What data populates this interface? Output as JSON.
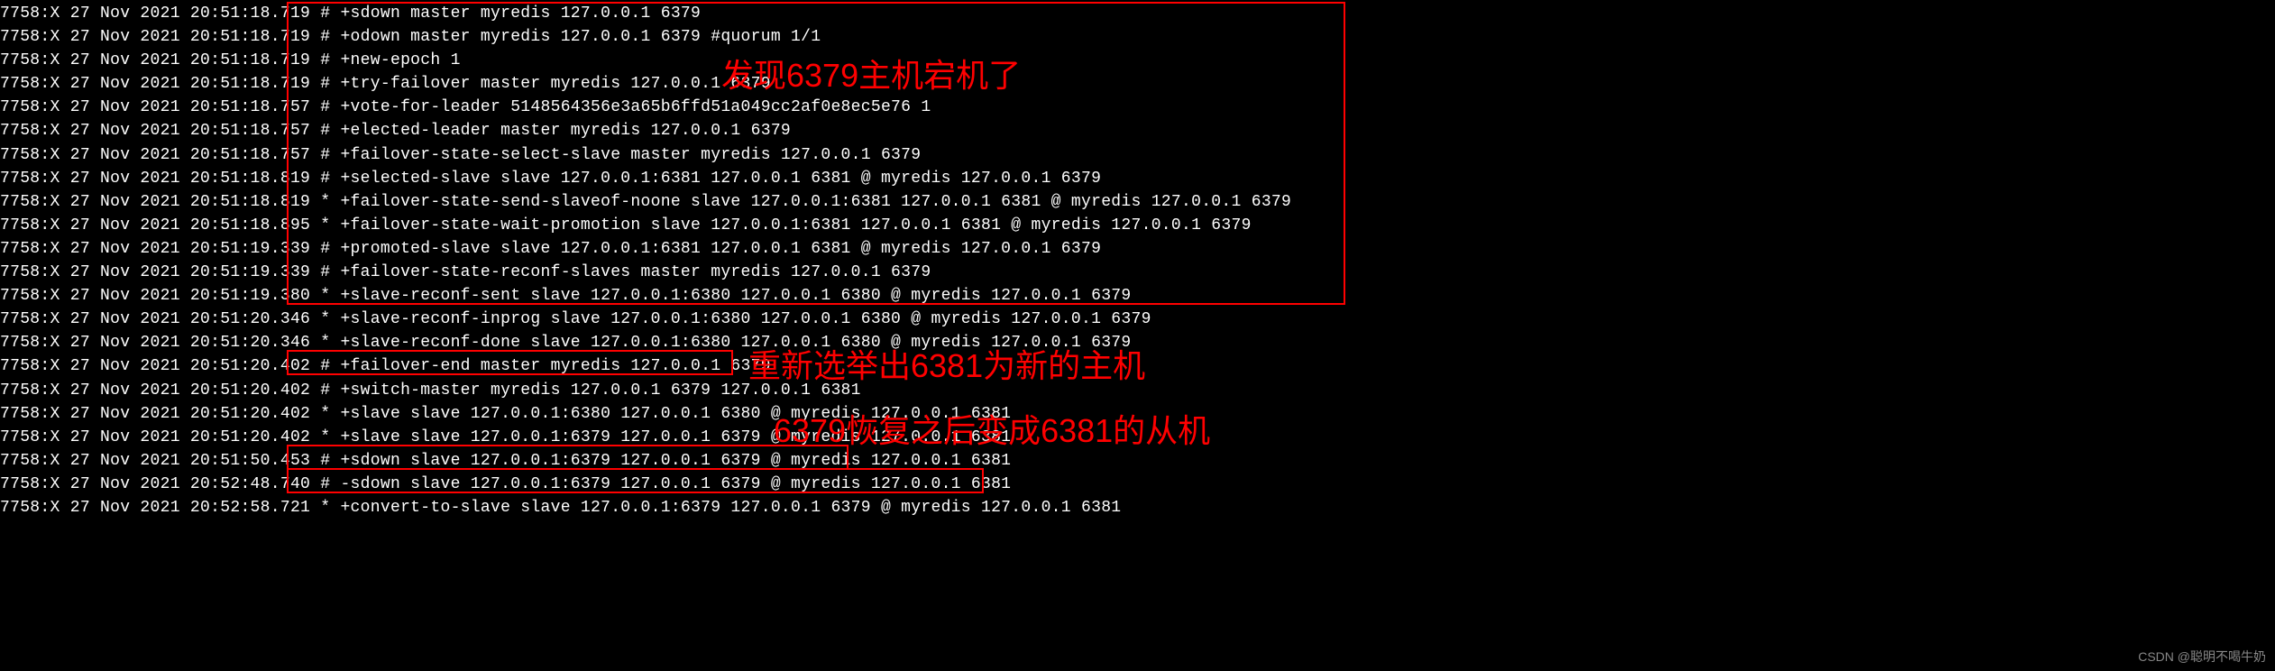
{
  "logs": [
    "7758:X 27 Nov 2021 20:51:18.719 # +sdown master myredis 127.0.0.1 6379",
    "7758:X 27 Nov 2021 20:51:18.719 # +odown master myredis 127.0.0.1 6379 #quorum 1/1",
    "7758:X 27 Nov 2021 20:51:18.719 # +new-epoch 1",
    "7758:X 27 Nov 2021 20:51:18.719 # +try-failover master myredis 127.0.0.1 6379",
    "7758:X 27 Nov 2021 20:51:18.757 # +vote-for-leader 5148564356e3a65b6ffd51a049cc2af0e8ec5e76 1",
    "7758:X 27 Nov 2021 20:51:18.757 # +elected-leader master myredis 127.0.0.1 6379",
    "7758:X 27 Nov 2021 20:51:18.757 # +failover-state-select-slave master myredis 127.0.0.1 6379",
    "7758:X 27 Nov 2021 20:51:18.819 # +selected-slave slave 127.0.0.1:6381 127.0.0.1 6381 @ myredis 127.0.0.1 6379",
    "7758:X 27 Nov 2021 20:51:18.819 * +failover-state-send-slaveof-noone slave 127.0.0.1:6381 127.0.0.1 6381 @ myredis 127.0.0.1 6379",
    "7758:X 27 Nov 2021 20:51:18.895 * +failover-state-wait-promotion slave 127.0.0.1:6381 127.0.0.1 6381 @ myredis 127.0.0.1 6379",
    "7758:X 27 Nov 2021 20:51:19.339 # +promoted-slave slave 127.0.0.1:6381 127.0.0.1 6381 @ myredis 127.0.0.1 6379",
    "7758:X 27 Nov 2021 20:51:19.339 # +failover-state-reconf-slaves master myredis 127.0.0.1 6379",
    "7758:X 27 Nov 2021 20:51:19.380 * +slave-reconf-sent slave 127.0.0.1:6380 127.0.0.1 6380 @ myredis 127.0.0.1 6379",
    "7758:X 27 Nov 2021 20:51:20.346 * +slave-reconf-inprog slave 127.0.0.1:6380 127.0.0.1 6380 @ myredis 127.0.0.1 6379",
    "7758:X 27 Nov 2021 20:51:20.346 * +slave-reconf-done slave 127.0.0.1:6380 127.0.0.1 6380 @ myredis 127.0.0.1 6379",
    "7758:X 27 Nov 2021 20:51:20.402 # +failover-end master myredis 127.0.0.1 6379",
    "7758:X 27 Nov 2021 20:51:20.402 # +switch-master myredis 127.0.0.1 6379 127.0.0.1 6381",
    "7758:X 27 Nov 2021 20:51:20.402 * +slave slave 127.0.0.1:6380 127.0.0.1 6380 @ myredis 127.0.0.1 6381",
    "7758:X 27 Nov 2021 20:51:20.402 * +slave slave 127.0.0.1:6379 127.0.0.1 6379 @ myredis 127.0.0.1 6381",
    "7758:X 27 Nov 2021 20:51:50.453 # +sdown slave 127.0.0.1:6379 127.0.0.1 6379 @ myredis 127.0.0.1 6381",
    "7758:X 27 Nov 2021 20:52:48.740 # -sdown slave 127.0.0.1:6379 127.0.0.1 6379 @ myredis 127.0.0.1 6381",
    "7758:X 27 Nov 2021 20:52:58.721 * +convert-to-slave slave 127.0.0.1:6379 127.0.0.1 6379 @ myredis 127.0.0.1 6381"
  ],
  "annotations": {
    "a1": "发现6379主机宕机了",
    "a2": "重新选举出6381为新的主机",
    "a3": "6379恢复之后变成6381的从机"
  },
  "watermark": "CSDN @聪明不喝牛奶"
}
